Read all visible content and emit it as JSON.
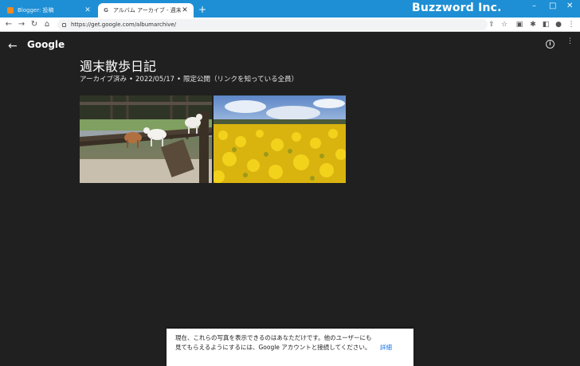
{
  "browser": {
    "tabs": [
      {
        "title": "Blogger: 投稿",
        "active": false
      },
      {
        "title": "アルバム アーカイブ - 週末散歩日記",
        "active": true
      }
    ],
    "new_tab": "+",
    "brand": "Buzzword Inc.",
    "url": "https://get.google.com/albumarchive/"
  },
  "header": {
    "logo": "Google"
  },
  "album": {
    "title": "週末散歩日記",
    "status": "アーカイブ済み",
    "separator": "•",
    "date": "2022/05/17",
    "visibility": "限定公開（リンクを知っている全員）"
  },
  "photos": [
    {
      "name": "goats-on-fence"
    },
    {
      "name": "rapeseed-field"
    }
  ],
  "toast": {
    "message": "現在、これらの写真を表示できるのはあなただけです。他のユーザーにも見てもらえるようにするには、Google アカウントと接続してください。",
    "link": "詳細"
  },
  "colors": {
    "tab_strip": "#1e8fd4",
    "page_bg": "#202020",
    "link": "#1a73e8"
  }
}
